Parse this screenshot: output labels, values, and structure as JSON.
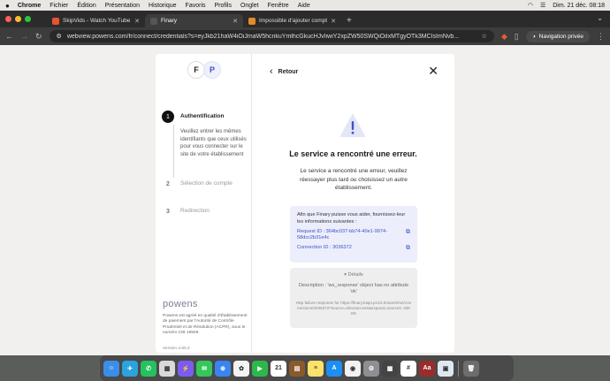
{
  "menubar": {
    "app": "Chrome",
    "items": [
      "Fichier",
      "Édition",
      "Présentation",
      "Historique",
      "Favoris",
      "Profils",
      "Onglet",
      "Fenêtre",
      "Aide"
    ],
    "datetime": "Dim. 21 déc.  08:18"
  },
  "tabs": [
    {
      "title": "SkipVids - Watch YouTube Vide",
      "icon_color": "#e8542f"
    },
    {
      "title": "Finary",
      "icon_color": "#555555"
    },
    {
      "title": "Impossible d'ajouter compte",
      "icon_color": "#e48a2a"
    }
  ],
  "toolbar": {
    "url": "webview.powens.com/fr/connect/credentials?s=eyJkb21haW4iOiJmaW5hcnkuYmlhcGkucHJvIiwiY2xpZW50SWQiOiIxMTgyOTk3MCIsImNvb...",
    "private_label": "Navigation privée"
  },
  "left": {
    "steps": [
      {
        "num": "1",
        "label": "Authentification"
      },
      {
        "num": "2",
        "label": "Sélection de compte"
      },
      {
        "num": "3",
        "label": "Redirection"
      }
    ],
    "step1_desc": "Veuillez entrer les mêmes identifiants que ceux utilisés pour vous connecter sur le site de votre établissement",
    "brand": "powens",
    "legal": "Powens est agréé en qualité d'Établissement de paiement par l'Autorité de Contrôle Prudentiel et de Résolution (ACPR), sous le numéro CIB 16948.",
    "version": "Version 4.60.2"
  },
  "right": {
    "back_label": "Retour",
    "error_title": "Le service a rencontré une erreur.",
    "error_message": "Le service a rencontré une erreur, veuillez réessayer plus tard ou choisissez un autre établissement.",
    "info_intro": "Afin que Finary puisse vous aider, fournissez-leur les informations suivantes :",
    "request_id": "Request ID : 364bc037-bb74-40e1-9974-58dcc2b31e4c",
    "connection_id": "Connection ID : 3036372",
    "details_label": "▾ Détails",
    "details_desc": "Description : 'ws_response' object has no attribute 'ok'",
    "details_raw": "Http failure response for https://finary.biapi.pro/2.0/users/me/connections/3036372?source=directaccess&expand=sources: 400 OK"
  },
  "dock": {
    "apps": [
      {
        "name": "finder",
        "color": "#3b8ee8",
        "glyph": "☺"
      },
      {
        "name": "telegram",
        "color": "#2aa3de",
        "glyph": "✈"
      },
      {
        "name": "whatsapp",
        "color": "#25c160",
        "glyph": "✆"
      },
      {
        "name": "launchpad",
        "color": "#d9d9d9",
        "glyph": "▦"
      },
      {
        "name": "messenger",
        "color": "#7b5cf2",
        "glyph": "⚡"
      },
      {
        "name": "messages",
        "color": "#34c759",
        "glyph": "✉"
      },
      {
        "name": "safari",
        "color": "#3a84f0",
        "glyph": "⊕"
      },
      {
        "name": "photos",
        "color": "#f3f3f3",
        "glyph": "✿"
      },
      {
        "name": "facetime",
        "color": "#2db84c",
        "glyph": "▶"
      },
      {
        "name": "calendar",
        "color": "#ffffff",
        "glyph": "21"
      },
      {
        "name": "notes-brown",
        "color": "#8a5a2b",
        "glyph": "▤"
      },
      {
        "name": "notes",
        "color": "#fbe26a",
        "glyph": "≡"
      },
      {
        "name": "app-store",
        "color": "#1d8ef3",
        "glyph": "A"
      },
      {
        "name": "chrome",
        "color": "#f2f2f2",
        "glyph": "◉"
      },
      {
        "name": "settings",
        "color": "#8e8e93",
        "glyph": "⚙"
      },
      {
        "name": "calculator",
        "color": "#444444",
        "glyph": "▦"
      },
      {
        "name": "slack",
        "color": "#ffffff",
        "glyph": "#"
      },
      {
        "name": "dictionary",
        "color": "#9b2c2c",
        "glyph": "Aa"
      },
      {
        "name": "preview",
        "color": "#dfe8f2",
        "glyph": "▣"
      },
      {
        "name": "trash",
        "color": "#6d6d6d",
        "glyph": "🗑"
      }
    ]
  }
}
